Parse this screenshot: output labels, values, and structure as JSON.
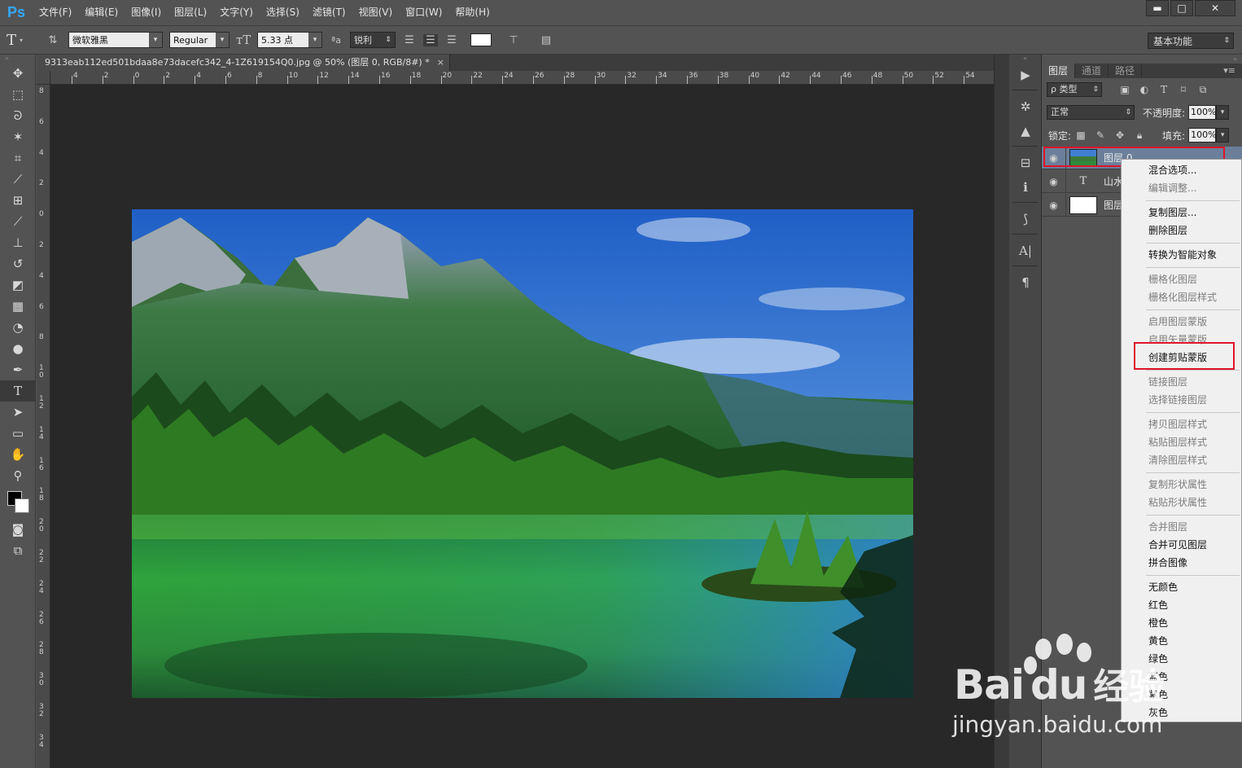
{
  "app": {
    "logo": "Ps",
    "menu": [
      "文件(F)",
      "编辑(E)",
      "图像(I)",
      "图层(L)",
      "文字(Y)",
      "选择(S)",
      "滤镜(T)",
      "视图(V)",
      "窗口(W)",
      "帮助(H)"
    ],
    "window_controls": [
      "▬",
      "□",
      "✕"
    ]
  },
  "options": {
    "tool_icon": "type-tool-icon",
    "font_family": "微软雅黑",
    "font_style": "Regular",
    "font_size": "5.33 点",
    "antialias": "锐利",
    "text_color": "#ffffff",
    "workspace": "基本功能"
  },
  "document": {
    "tab_title": "9313eab112ed501bdaa8e73dacefc342_4-1Z619154Q0.jpg @ 50% (图层 0, RGB/8#) *",
    "close": "×",
    "ruler_h": [
      "4",
      "2",
      "0",
      "2",
      "4",
      "6",
      "8",
      "10",
      "12",
      "14",
      "16",
      "18",
      "20",
      "22",
      "24",
      "26",
      "28",
      "30",
      "32",
      "34",
      "36",
      "38",
      "40",
      "42",
      "44",
      "46",
      "48",
      "50",
      "52",
      "54"
    ],
    "ruler_v": [
      "8",
      "6",
      "4",
      "2",
      "0",
      "2",
      "4",
      "6",
      "8",
      "10",
      "12",
      "14",
      "16",
      "18",
      "20",
      "22",
      "24",
      "26",
      "28",
      "30",
      "32",
      "34"
    ]
  },
  "layers_panel": {
    "tabs": [
      "图层",
      "通道",
      "路径"
    ],
    "filter_kind": "ρ 类型",
    "blend_mode": "正常",
    "opacity_label": "不透明度:",
    "opacity": "100%",
    "lock_label": "锁定:",
    "fill_label": "填充:",
    "fill": "100%",
    "layers": [
      {
        "name": "图层 0",
        "kind": "image",
        "visible": true,
        "selected": true
      },
      {
        "name": "山水",
        "kind": "text",
        "visible": true,
        "selected": false
      },
      {
        "name": "图层",
        "kind": "fill",
        "visible": true,
        "selected": false
      }
    ]
  },
  "context_menu": {
    "items": [
      {
        "label": "混合选项...",
        "enabled": true
      },
      {
        "label": "编辑调整...",
        "enabled": false
      },
      {
        "sep": true
      },
      {
        "label": "复制图层...",
        "enabled": true
      },
      {
        "label": "删除图层",
        "enabled": true
      },
      {
        "sep": true
      },
      {
        "label": "转换为智能对象",
        "enabled": true
      },
      {
        "sep": true
      },
      {
        "label": "栅格化图层",
        "enabled": false
      },
      {
        "label": "栅格化图层样式",
        "enabled": false
      },
      {
        "sep": true
      },
      {
        "label": "启用图层蒙版",
        "enabled": false
      },
      {
        "label": "启用矢量蒙版",
        "enabled": false
      },
      {
        "label": "创建剪贴蒙版",
        "enabled": true,
        "highlight": true
      },
      {
        "sep": true
      },
      {
        "label": "链接图层",
        "enabled": false
      },
      {
        "label": "选择链接图层",
        "enabled": false
      },
      {
        "sep": true
      },
      {
        "label": "拷贝图层样式",
        "enabled": false
      },
      {
        "label": "粘贴图层样式",
        "enabled": false
      },
      {
        "label": "清除图层样式",
        "enabled": false
      },
      {
        "sep": true
      },
      {
        "label": "复制形状属性",
        "enabled": false
      },
      {
        "label": "粘贴形状属性",
        "enabled": false
      },
      {
        "sep": true
      },
      {
        "label": "合并图层",
        "enabled": false
      },
      {
        "label": "合并可见图层",
        "enabled": true
      },
      {
        "label": "拼合图像",
        "enabled": true
      },
      {
        "sep": true
      },
      {
        "label": "无颜色",
        "enabled": true
      },
      {
        "label": "红色",
        "enabled": true
      },
      {
        "label": "橙色",
        "enabled": true
      },
      {
        "label": "黄色",
        "enabled": true
      },
      {
        "label": "绿色",
        "enabled": true
      },
      {
        "label": "蓝色",
        "enabled": true
      },
      {
        "label": "紫色",
        "enabled": true
      },
      {
        "label": "灰色",
        "enabled": true
      }
    ]
  },
  "watermark": {
    "brand": "Bai",
    "brand2": "du",
    "brand3": "经验",
    "url": "jingyan.baidu.com"
  },
  "colors": {
    "highlight_box": "#e1142a",
    "selected_layer": "#6b7f9a"
  }
}
